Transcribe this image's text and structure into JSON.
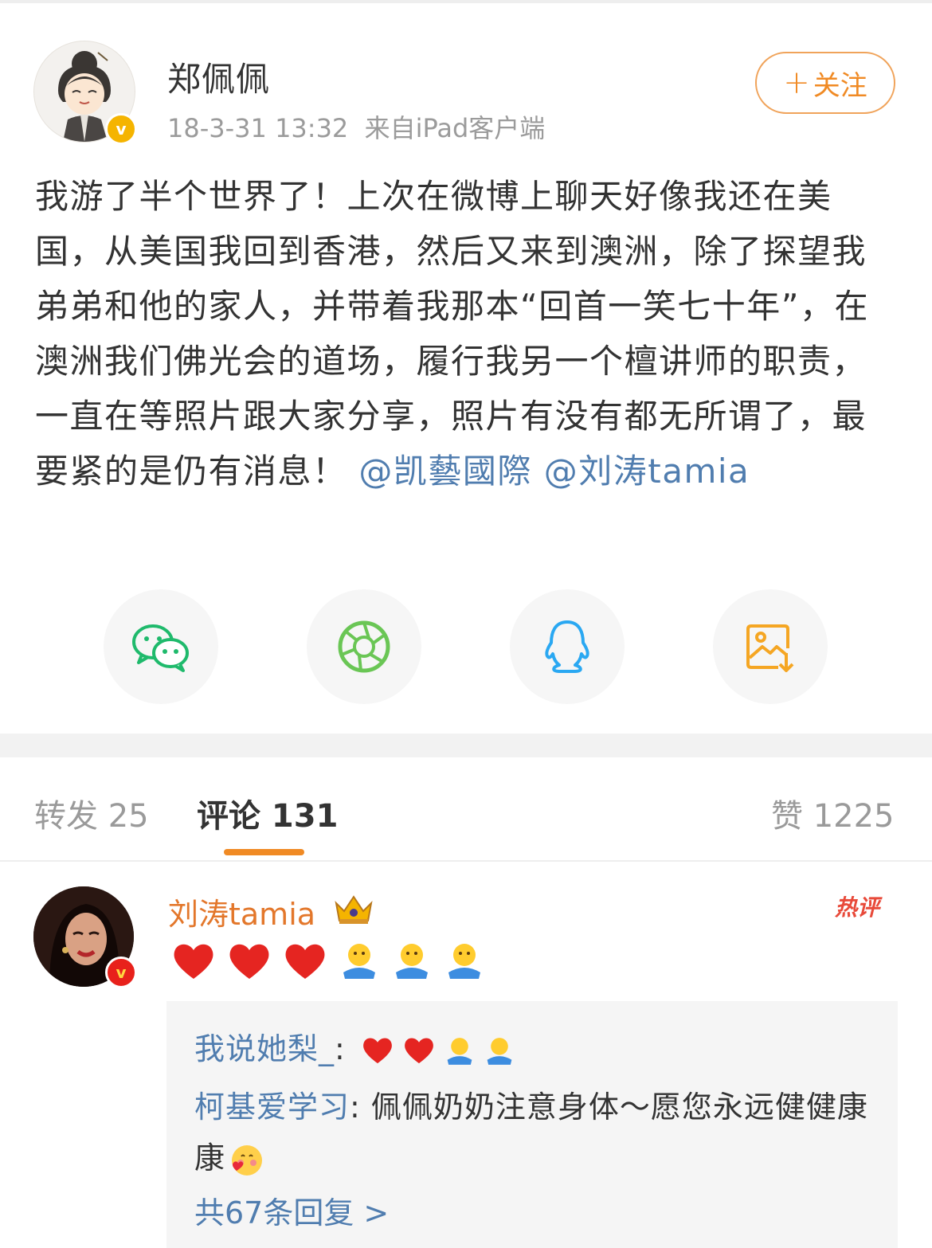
{
  "post": {
    "author": "郑佩佩",
    "timestamp": "18-3-31 13:32",
    "source": "来自iPad客户端",
    "follow_label": "关注",
    "follow_plus": "+",
    "text": "我游了半个世界了！上次在微博上聊天好像我还在美国，从美国我回到香港，然后又来到澳洲，除了探望我弟弟和他的家人，并带着我那本“回首一笑七十年”，在澳洲我们佛光会的道场，履行我另一个檀讲师的职责，一直在等照片跟大家分享，照片有没有都无所谓了，最要紧的是仍有消息！",
    "mentions": [
      "@凯藝國際",
      "@刘涛tamia"
    ],
    "verified_badge": "v"
  },
  "share": [
    {
      "icon": "wechat-icon",
      "color": "#1fba6c"
    },
    {
      "icon": "moments-icon",
      "color": "#6ac655"
    },
    {
      "icon": "qq-icon",
      "color": "#2aa8f2"
    },
    {
      "icon": "save-image-icon",
      "color": "#f5a623"
    }
  ],
  "tabs": {
    "repost": "转发 25",
    "comment": "评论 131",
    "like": "赞 1225"
  },
  "comment": {
    "author": "刘涛tamia",
    "hot_badge": "热评",
    "verified_badge": "v",
    "emojis": [
      "heart",
      "heart",
      "heart",
      "hug",
      "hug",
      "hug"
    ],
    "replies": [
      {
        "name": "我说她梨_",
        "text": "",
        "emojis": [
          "heart",
          "heart",
          "hug",
          "hug"
        ]
      },
      {
        "name": "柯基爱学习",
        "text": "佩佩奶奶注意身体～愿您永远健健康康",
        "emojis": [
          "blush-heart"
        ]
      }
    ],
    "more_replies": "共67条回复 >"
  }
}
